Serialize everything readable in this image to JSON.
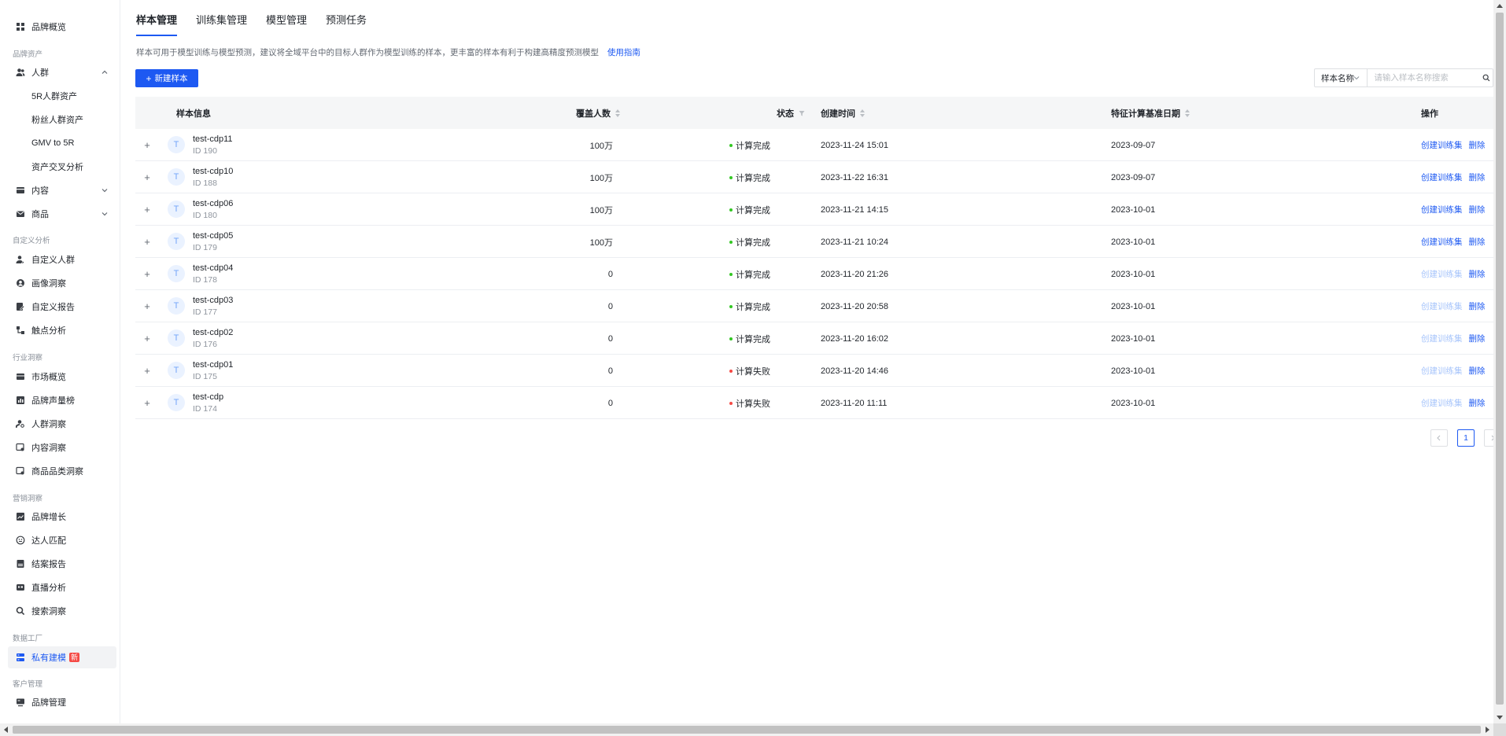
{
  "sidebar": {
    "overview": "品牌概览",
    "group_brand_assets": "品牌资产",
    "crowd": "人群",
    "crowd_sub": [
      "5R人群资产",
      "粉丝人群资产",
      "GMV to 5R",
      "资产交叉分析"
    ],
    "content": "内容",
    "goods": "商品",
    "group_custom": "自定义分析",
    "custom_items": [
      "自定义人群",
      "画像洞察",
      "自定义报告",
      "触点分析"
    ],
    "group_industry": "行业洞察",
    "industry_items": [
      "市场概览",
      "品牌声量榜",
      "人群洞察",
      "内容洞察",
      "商品品类洞察"
    ],
    "group_marketing": "营销洞察",
    "marketing_items": [
      "品牌增长",
      "达人匹配",
      "结案报告",
      "直播分析",
      "搜索洞察"
    ],
    "group_data_factory": "数据工厂",
    "private_modeling": "私有建模",
    "new_badge": "新",
    "group_customer": "客户管理",
    "brand_management": "品牌管理"
  },
  "tabs": [
    "样本管理",
    "训练集管理",
    "模型管理",
    "预测任务"
  ],
  "description": "样本可用于模型训练与模型预测，建议将全域平台中的目标人群作为模型训练的样本，更丰富的样本有利于构建高精度预测模型",
  "guide_link": "使用指南",
  "new_sample_button": "新建样本",
  "new_sample_plus": "+",
  "search": {
    "field": "样本名称",
    "placeholder": "请输入样本名称搜索"
  },
  "table": {
    "headers": {
      "info": "样本信息",
      "coverage": "覆盖人数",
      "status": "状态",
      "created": "创建时间",
      "feature_date": "特征计算基准日期",
      "ops": "操作"
    },
    "id_prefix": "ID",
    "expand_symbol": "+",
    "avatar_letter": "T",
    "op_create": "创建训练集",
    "op_delete": "删除",
    "rows": [
      {
        "name": "test-cdp11",
        "id": "190",
        "coverage": "100万",
        "status": "计算完成",
        "ok": true,
        "created": "2023-11-24 15:01",
        "feature_date": "2023-09-07"
      },
      {
        "name": "test-cdp10",
        "id": "188",
        "coverage": "100万",
        "status": "计算完成",
        "ok": true,
        "created": "2023-11-22 16:31",
        "feature_date": "2023-09-07"
      },
      {
        "name": "test-cdp06",
        "id": "180",
        "coverage": "100万",
        "status": "计算完成",
        "ok": true,
        "created": "2023-11-21 14:15",
        "feature_date": "2023-10-01"
      },
      {
        "name": "test-cdp05",
        "id": "179",
        "coverage": "100万",
        "status": "计算完成",
        "ok": true,
        "created": "2023-11-21 10:24",
        "feature_date": "2023-10-01"
      },
      {
        "name": "test-cdp04",
        "id": "178",
        "coverage": "0",
        "status": "计算完成",
        "ok": true,
        "created": "2023-11-20 21:26",
        "feature_date": "2023-10-01"
      },
      {
        "name": "test-cdp03",
        "id": "177",
        "coverage": "0",
        "status": "计算完成",
        "ok": true,
        "created": "2023-11-20 20:58",
        "feature_date": "2023-10-01"
      },
      {
        "name": "test-cdp02",
        "id": "176",
        "coverage": "0",
        "status": "计算完成",
        "ok": true,
        "created": "2023-11-20 16:02",
        "feature_date": "2023-10-01"
      },
      {
        "name": "test-cdp01",
        "id": "175",
        "coverage": "0",
        "status": "计算失败",
        "ok": false,
        "created": "2023-11-20 14:46",
        "feature_date": "2023-10-01"
      },
      {
        "name": "test-cdp",
        "id": "174",
        "coverage": "0",
        "status": "计算失败",
        "ok": false,
        "created": "2023-11-20 11:11",
        "feature_date": "2023-10-01"
      }
    ]
  },
  "pagination": {
    "current": "1"
  },
  "colors": {
    "accent": "#1d59f2",
    "success": "#34c724",
    "error": "#f54a45"
  }
}
